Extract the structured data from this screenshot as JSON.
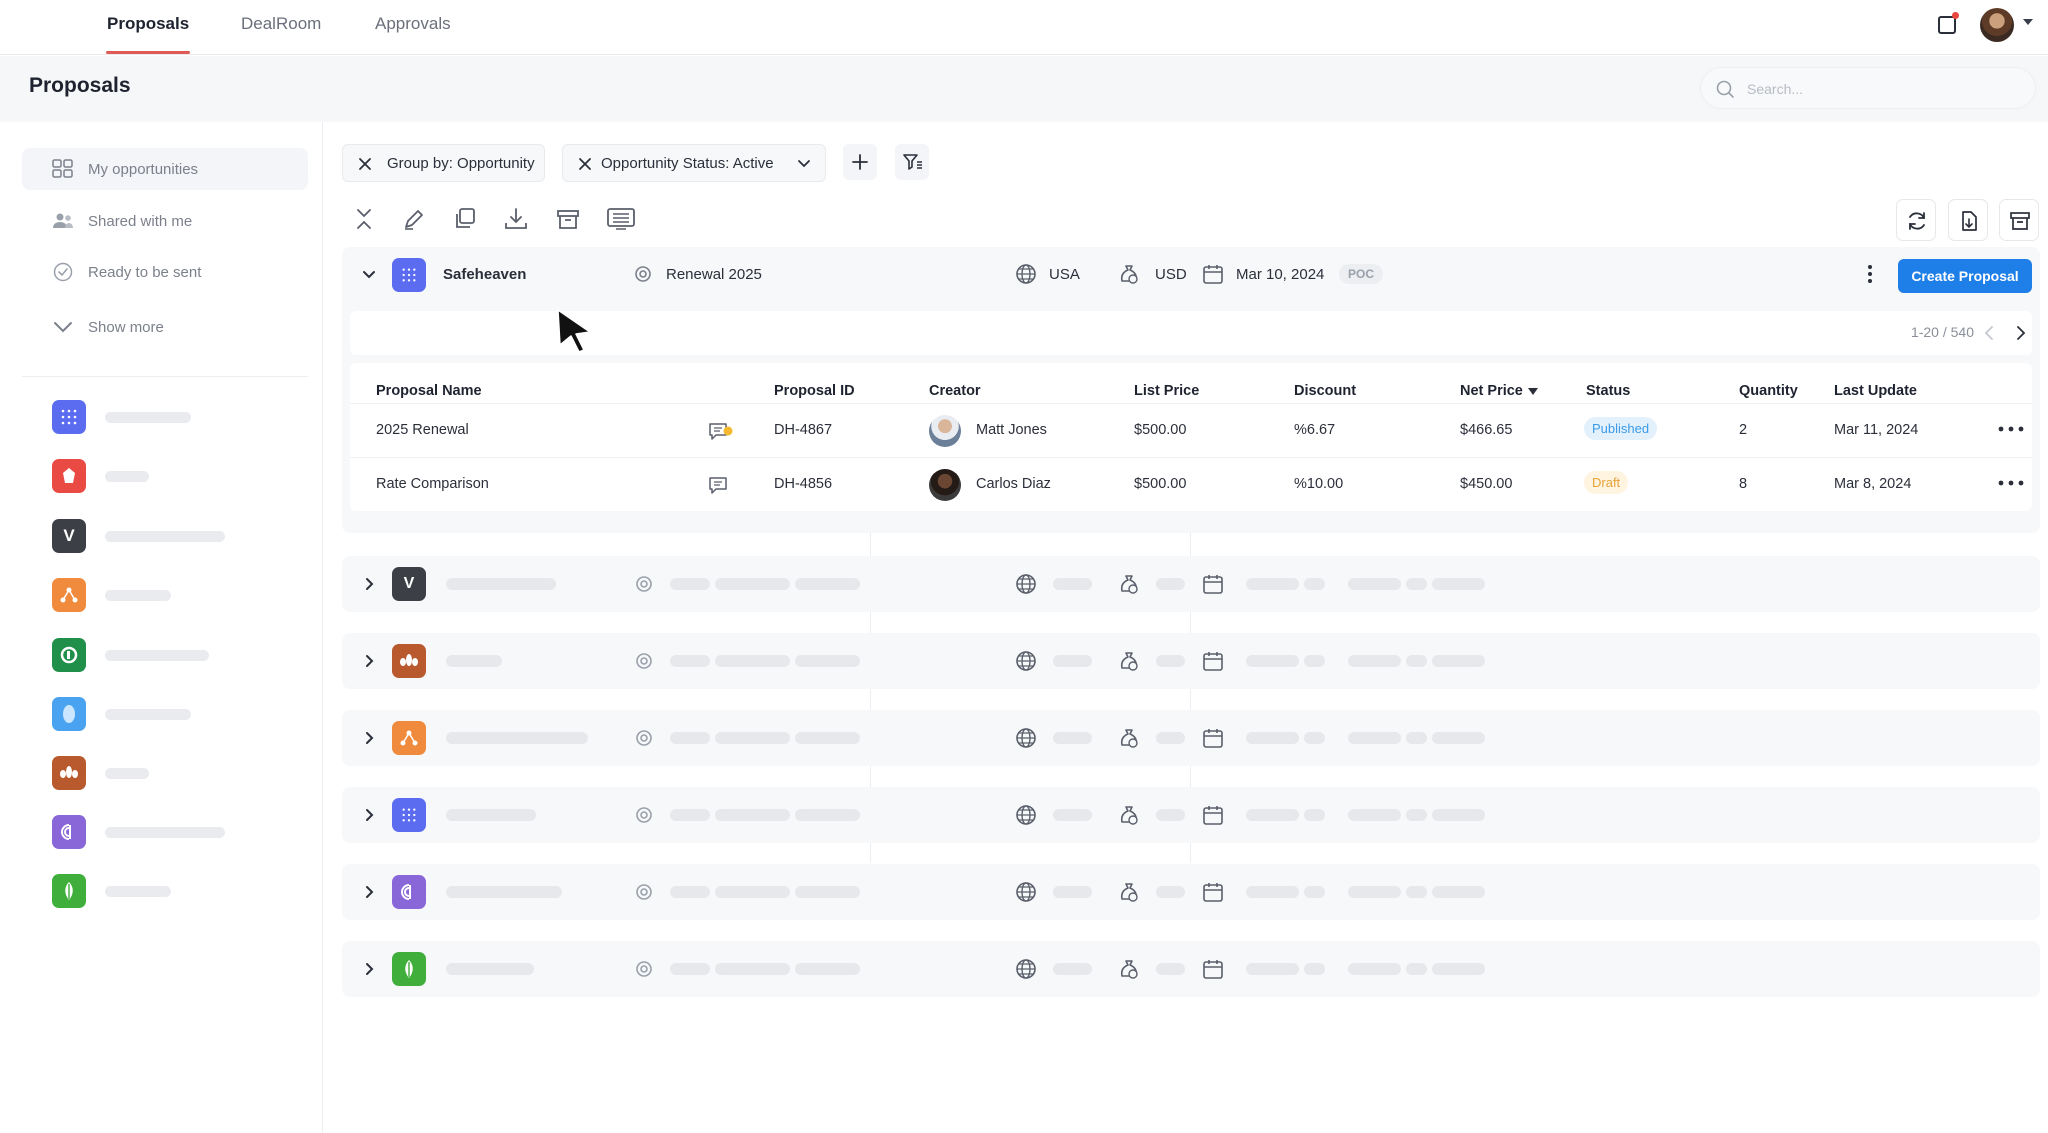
{
  "nav": {
    "tabs": [
      {
        "label": "Proposals",
        "active": true
      },
      {
        "label": "DealRoom",
        "active": false
      },
      {
        "label": "Approvals",
        "active": false
      }
    ]
  },
  "header": {
    "title": "Proposals",
    "search_placeholder": "Search..."
  },
  "sidebar": {
    "items": [
      {
        "label": "My opportunities",
        "icon": "grid-icon",
        "active": true
      },
      {
        "label": "Shared with me",
        "icon": "users-icon",
        "active": false
      },
      {
        "label": "Ready to be sent",
        "icon": "check-circle-icon",
        "active": false
      },
      {
        "label": "Show more",
        "icon": "chevron-down-icon",
        "active": false
      }
    ],
    "accounts": [
      {
        "letter": "",
        "color": "#5b6cf0"
      },
      {
        "letter": "",
        "color": "#ea4a44"
      },
      {
        "letter": "V",
        "color": "#3c3f46"
      },
      {
        "letter": "",
        "color": "#f08a3c"
      },
      {
        "letter": "",
        "color": "#1f8f4a"
      },
      {
        "letter": "",
        "color": "#4aa3f0"
      },
      {
        "letter": "",
        "color": "#b85a2e"
      },
      {
        "letter": "",
        "color": "#8a67d8"
      },
      {
        "letter": "",
        "color": "#3fae3a"
      }
    ]
  },
  "filters": {
    "group_by": "Group by: Opportunity",
    "status": "Opportunity Status: Active"
  },
  "group": {
    "name": "Safeheaven",
    "opportunity": "Renewal 2025",
    "country": "USA",
    "currency": "USD",
    "date": "Mar 10, 2024",
    "tag": "POC",
    "create_label": "Create Proposal",
    "pager": "1-20 / 540"
  },
  "table": {
    "columns": [
      "Proposal Name",
      "Proposal ID",
      "Creator",
      "List Price",
      "Discount",
      "Net Price",
      "Status",
      "Quantity",
      "Last Update"
    ],
    "rows": [
      {
        "name": "2025 Renewal",
        "id": "DH-4867",
        "creator": "Matt Jones",
        "list_price": "$500.00",
        "discount": "%6.67",
        "net_price": "$466.65",
        "status": "Published",
        "quantity": "2",
        "last_update": "Mar 11, 2024"
      },
      {
        "name": "Rate Comparison",
        "id": "DH-4856",
        "creator": "Carlos Diaz",
        "list_price": "$500.00",
        "discount": "%10.00",
        "net_price": "$450.00",
        "status": "Draft",
        "quantity": "8",
        "last_update": "Mar 8, 2024"
      }
    ]
  },
  "collapsed_groups": [
    {
      "letter": "V",
      "color": "#3c3f46"
    },
    {
      "letter": "",
      "color": "#b85a2e"
    },
    {
      "letter": "",
      "color": "#f08a3c"
    },
    {
      "letter": "",
      "color": "#5b6cf0"
    },
    {
      "letter": "",
      "color": "#8a67d8"
    },
    {
      "letter": "",
      "color": "#3fae3a"
    }
  ],
  "colors": {
    "accent": "#1f7fe8",
    "tab_underline": "#e05a55",
    "published_bg": "#e3f1fd",
    "published_fg": "#3b9be8",
    "draft_bg": "#fff4e0",
    "draft_fg": "#e8a23a"
  }
}
